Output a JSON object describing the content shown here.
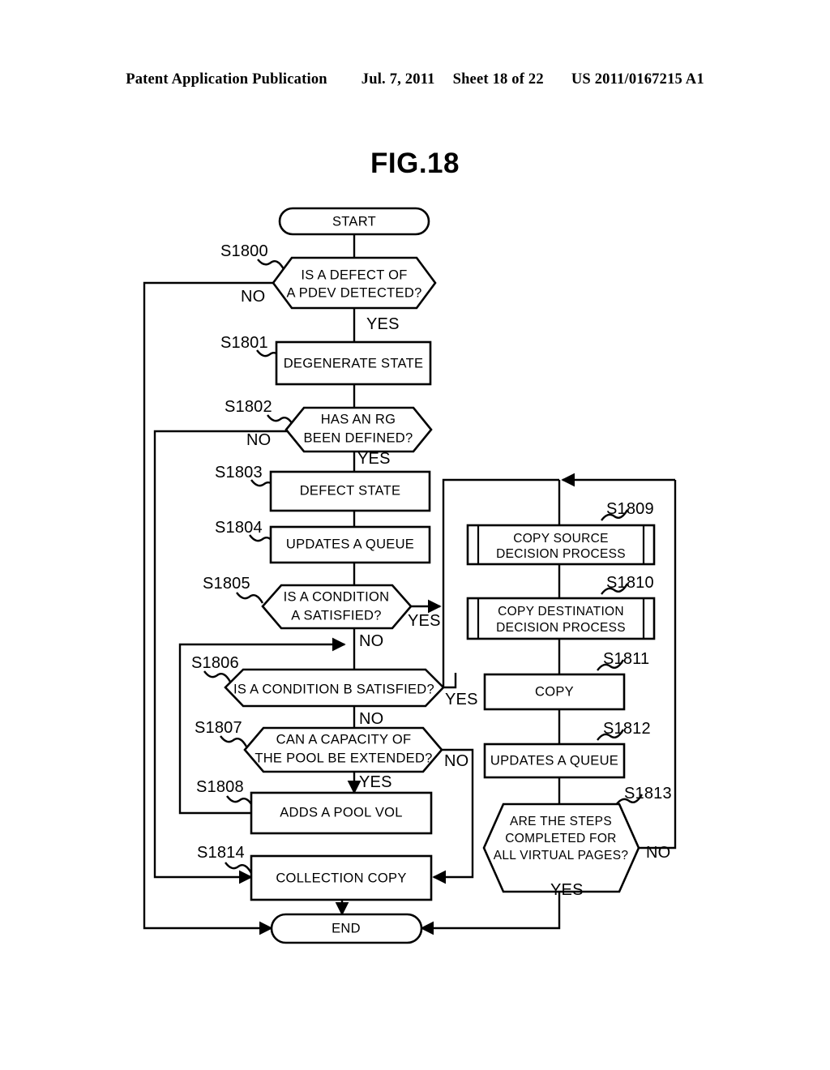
{
  "header": {
    "publication": "Patent Application Publication",
    "date": "Jul. 7, 2011",
    "sheet": "Sheet 18 of 22",
    "patent_number": "US 2011/0167215 A1"
  },
  "figure": {
    "title": "FIG.18"
  },
  "chart_data": {
    "type": "diagram",
    "title": "FIG.18",
    "diagram_kind": "flowchart",
    "nodes": [
      {
        "id": "start",
        "shape": "terminator",
        "label": "START",
        "step": ""
      },
      {
        "id": "S1800",
        "shape": "decision",
        "step": "S1800",
        "lines": [
          "IS A DEFECT OF",
          "A PDEV DETECTED?"
        ]
      },
      {
        "id": "S1801",
        "shape": "process",
        "step": "S1801",
        "lines": [
          "DEGENERATE STATE"
        ]
      },
      {
        "id": "S1802",
        "shape": "decision",
        "step": "S1802",
        "lines": [
          "HAS AN RG",
          "BEEN DEFINED?"
        ]
      },
      {
        "id": "S1803",
        "shape": "process",
        "step": "S1803",
        "lines": [
          "DEFECT STATE"
        ]
      },
      {
        "id": "S1804",
        "shape": "process",
        "step": "S1804",
        "lines": [
          "UPDATES A QUEUE"
        ]
      },
      {
        "id": "S1805",
        "shape": "decision",
        "step": "S1805",
        "lines": [
          "IS A CONDITION",
          "A SATISFIED?"
        ]
      },
      {
        "id": "S1806",
        "shape": "decision",
        "step": "S1806",
        "lines": [
          "IS A CONDITION B SATISFIED?"
        ]
      },
      {
        "id": "S1807",
        "shape": "decision",
        "step": "S1807",
        "lines": [
          "CAN A CAPACITY OF",
          "THE POOL BE EXTENDED?"
        ]
      },
      {
        "id": "S1808",
        "shape": "process",
        "step": "S1808",
        "lines": [
          "ADDS A POOL VOL"
        ]
      },
      {
        "id": "S1809",
        "shape": "predefined-process",
        "step": "S1809",
        "lines": [
          "COPY SOURCE",
          "DECISION PROCESS"
        ]
      },
      {
        "id": "S1810",
        "shape": "predefined-process",
        "step": "S1810",
        "lines": [
          "COPY DESTINATION",
          "DECISION PROCESS"
        ]
      },
      {
        "id": "S1811",
        "shape": "process",
        "step": "S1811",
        "lines": [
          "COPY"
        ]
      },
      {
        "id": "S1812",
        "shape": "process",
        "step": "S1812",
        "lines": [
          "UPDATES A QUEUE"
        ]
      },
      {
        "id": "S1813",
        "shape": "decision",
        "step": "S1813",
        "lines": [
          "ARE THE STEPS",
          "COMPLETED FOR",
          "ALL VIRTUAL PAGES?"
        ]
      },
      {
        "id": "S1814",
        "shape": "process",
        "step": "S1814",
        "lines": [
          "COLLECTION COPY"
        ]
      },
      {
        "id": "end",
        "shape": "terminator",
        "label": "END",
        "step": ""
      }
    ],
    "edges": [
      {
        "from": "start",
        "to": "S1800",
        "label": ""
      },
      {
        "from": "S1800",
        "to": "end",
        "label": "NO"
      },
      {
        "from": "S1800",
        "to": "S1801",
        "label": "YES"
      },
      {
        "from": "S1801",
        "to": "S1802",
        "label": ""
      },
      {
        "from": "S1802",
        "to": "S1814",
        "label": "NO"
      },
      {
        "from": "S1802",
        "to": "S1803",
        "label": "YES"
      },
      {
        "from": "S1803",
        "to": "S1804",
        "label": ""
      },
      {
        "from": "S1804",
        "to": "S1805",
        "label": ""
      },
      {
        "from": "S1805",
        "to": "S1809",
        "label": "YES"
      },
      {
        "from": "S1805",
        "to": "S1806",
        "label": "NO"
      },
      {
        "from": "S1806",
        "to": "S1809",
        "label": "YES"
      },
      {
        "from": "S1806",
        "to": "S1807",
        "label": "NO"
      },
      {
        "from": "S1807",
        "to": "S1808",
        "label": "YES"
      },
      {
        "from": "S1807",
        "to": "S1814",
        "label": "NO"
      },
      {
        "from": "S1808",
        "to": "S1806",
        "label": ""
      },
      {
        "from": "S1809",
        "to": "S1810",
        "label": ""
      },
      {
        "from": "S1810",
        "to": "S1811",
        "label": ""
      },
      {
        "from": "S1811",
        "to": "S1812",
        "label": ""
      },
      {
        "from": "S1812",
        "to": "S1813",
        "label": ""
      },
      {
        "from": "S1813",
        "to": "S1809",
        "label": "NO"
      },
      {
        "from": "S1813",
        "to": "end",
        "label": "YES"
      },
      {
        "from": "S1814",
        "to": "end",
        "label": ""
      }
    ],
    "branch_labels": {
      "s1800_no": "NO",
      "s1800_yes": "YES",
      "s1802_no": "NO",
      "s1802_yes": "YES",
      "s1805_yes": "YES",
      "s1805_no": "NO",
      "s1806_yes": "YES",
      "s1806_no": "NO",
      "s1807_yes": "YES",
      "s1807_no": "NO",
      "s1813_no": "NO",
      "s1813_yes": "YES"
    }
  }
}
